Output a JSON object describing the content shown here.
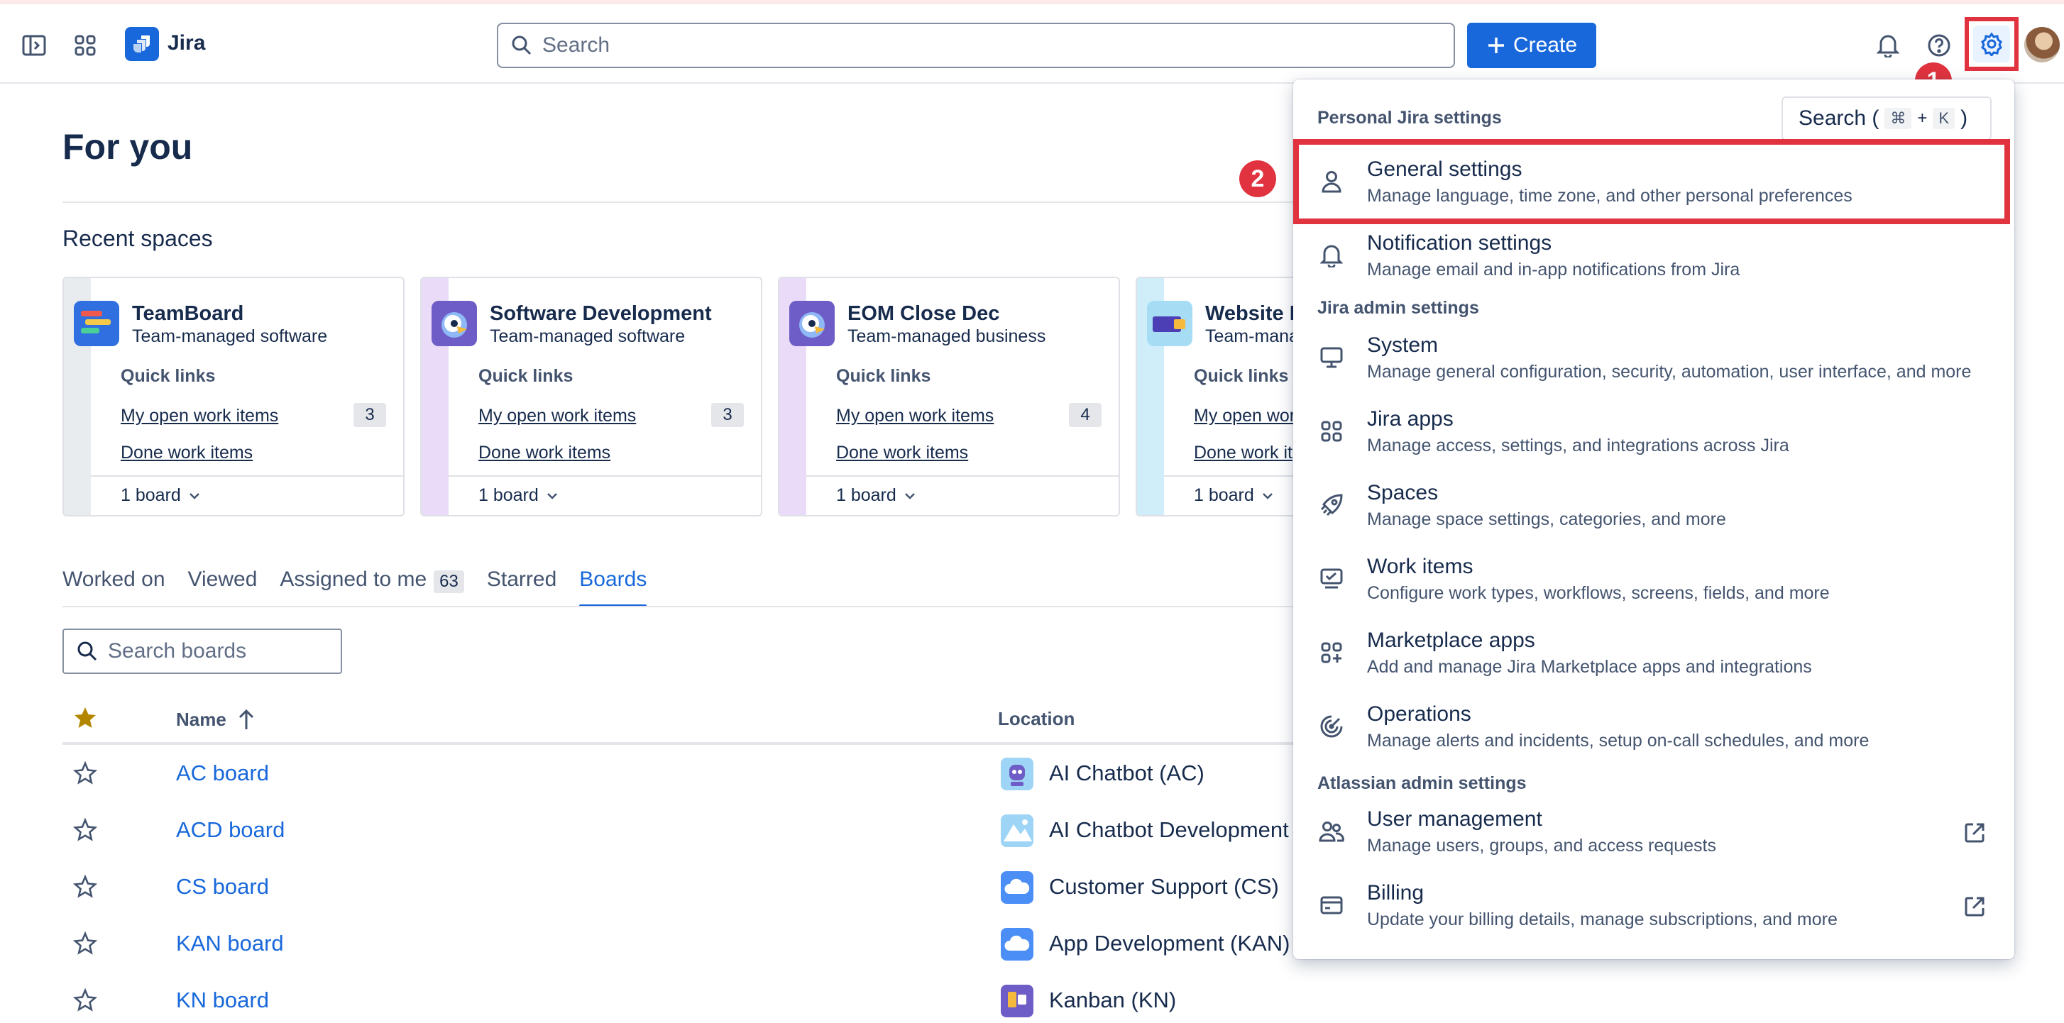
{
  "app": {
    "name": "Jira"
  },
  "topbar": {
    "search_placeholder": "Search",
    "create_label": "Create"
  },
  "callouts": {
    "one": "1",
    "two": "2"
  },
  "main": {
    "title": "For you",
    "recent_title": "Recent spaces",
    "spaces": [
      {
        "name": "TeamBoard",
        "type": "Team-managed software",
        "quick_links": "Quick links",
        "open_items": "My open work items",
        "open_count": "3",
        "done_items": "Done work items",
        "boards": "1 board"
      },
      {
        "name": "Software Development",
        "type": "Team-managed software",
        "quick_links": "Quick links",
        "open_items": "My open work items",
        "open_count": "3",
        "done_items": "Done work items",
        "boards": "1 board"
      },
      {
        "name": "EOM Close Dec",
        "type": "Team-managed business",
        "quick_links": "Quick links",
        "open_items": "My open work items",
        "open_count": "4",
        "done_items": "Done work items",
        "boards": "1 board"
      },
      {
        "name": "Website R",
        "type": "Team-mana",
        "quick_links": "Quick links",
        "open_items": "My open wor",
        "open_count": "",
        "done_items": "Done work it",
        "boards": "1 board"
      }
    ],
    "tabs": [
      {
        "label": "Worked on"
      },
      {
        "label": "Viewed"
      },
      {
        "label": "Assigned to me",
        "count": "63"
      },
      {
        "label": "Starred"
      },
      {
        "label": "Boards",
        "active": true
      }
    ],
    "search_boards_placeholder": "Search boards",
    "table": {
      "col_name": "Name",
      "col_location": "Location",
      "rows": [
        {
          "name": "AC board",
          "location": "AI Chatbot (AC)"
        },
        {
          "name": "ACD board",
          "location": "AI Chatbot Development ("
        },
        {
          "name": "CS board",
          "location": "Customer Support (CS)"
        },
        {
          "name": "KAN board",
          "location": "App Development (KAN)"
        },
        {
          "name": "KN board",
          "location": "Kanban (KN)"
        }
      ]
    }
  },
  "settings_menu": {
    "personal_header": "Personal Jira settings",
    "search_label": "Search (",
    "search_key1": "⌘",
    "search_plus": "+",
    "search_key2": "K",
    "search_close": ")",
    "personal_items": [
      {
        "title": "General settings",
        "desc": "Manage language, time zone, and other personal preferences",
        "icon": "person-icon"
      },
      {
        "title": "Notification settings",
        "desc": "Manage email and in-app notifications from Jira",
        "icon": "bell-icon"
      }
    ],
    "admin_header": "Jira admin settings",
    "admin_items": [
      {
        "title": "System",
        "desc": "Manage general configuration, security, automation, user interface, and more",
        "icon": "monitor-icon"
      },
      {
        "title": "Jira apps",
        "desc": "Manage access, settings, and integrations across Jira",
        "icon": "apps-icon"
      },
      {
        "title": "Spaces",
        "desc": "Manage space settings, categories, and more",
        "icon": "rocket-icon"
      },
      {
        "title": "Work items",
        "desc": "Configure work types, workflows, screens, fields, and more",
        "icon": "work-items-icon"
      },
      {
        "title": "Marketplace apps",
        "desc": "Add and manage Jira Marketplace apps and integrations",
        "icon": "marketplace-icon"
      },
      {
        "title": "Operations",
        "desc": "Manage alerts and incidents, setup on-call schedules, and more",
        "icon": "operations-icon"
      }
    ],
    "atlassian_header": "Atlassian admin settings",
    "atlassian_items": [
      {
        "title": "User management",
        "desc": "Manage users, groups, and access requests",
        "icon": "people-icon"
      },
      {
        "title": "Billing",
        "desc": "Update your billing details, manage subscriptions, and more",
        "icon": "credit-card-icon"
      }
    ]
  }
}
